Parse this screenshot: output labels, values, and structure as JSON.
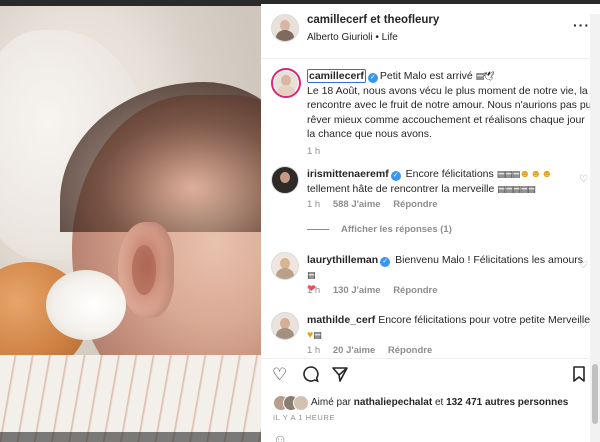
{
  "post": {
    "header_users": "camillecerf et theofleury",
    "audio": "Alberto Giurioli",
    "audio_sep": "•",
    "audio_tag": "Life",
    "more_label": "···"
  },
  "caption": {
    "username": "camillecerf",
    "text_start": "Petit Malo est arrivé",
    "body": "Le 18 Août, nous avons vécu le plus moment de notre vie, la rencontre avec le fruit de notre amour. Nous n'aurions pas pu rêver mieux comme accouchement et réalisons chaque jour la chance que nous avons.",
    "time": "1 h"
  },
  "comments": [
    {
      "username": "irismittenaeremf",
      "text": "Encore félicitations",
      "text2": "tellement hâte de rencontrer la merveille",
      "time": "1 h",
      "likes": "588 J'aime",
      "reply": "Répondre"
    },
    {
      "username": "laurythilleman",
      "text": "Bienvenu Malo ! Félicitations les amours",
      "time": "1 h",
      "likes": "130 J'aime",
      "reply": "Répondre"
    },
    {
      "username": "mathilde_cerf",
      "text": "Encore félicitations pour votre petite Merveille",
      "time": "1 h",
      "likes": "20 J'aime",
      "reply": "Répondre"
    }
  ],
  "view_replies": "Afficher les réponses (1)",
  "likes_summary": {
    "prefix": "Aimé par",
    "user": "nathaliepechalat",
    "middle": "et",
    "others": "132 471 autres personnes"
  },
  "time_ago": "IL Y A 1 HEURE",
  "icons": {
    "like": "heart-outline-icon",
    "comment": "comment-bubble-icon",
    "share": "paper-plane-icon",
    "save": "bookmark-icon",
    "verified": "verified-badge-icon",
    "more": "more-dots-icon"
  },
  "colors": {
    "verified": "#3797f0",
    "link": "#00376b",
    "muted": "#8e8e8e",
    "heart": "#ed4956"
  }
}
